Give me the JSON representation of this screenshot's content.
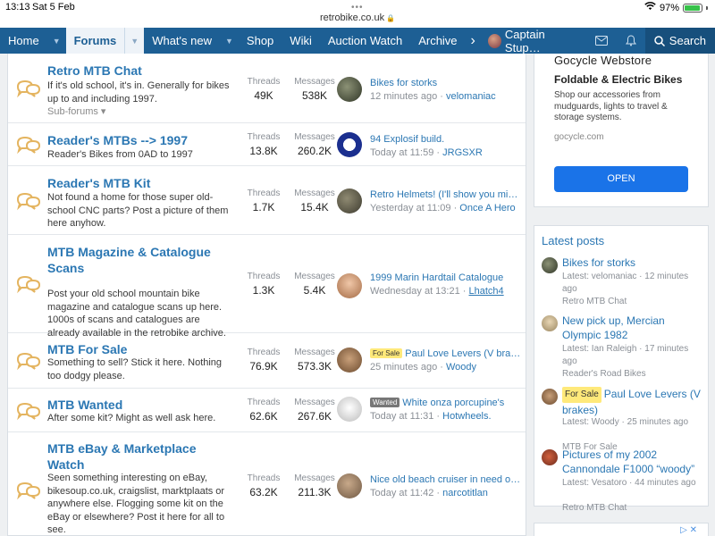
{
  "status_bar": {
    "time": "13:13",
    "date": "Sat 5 Feb",
    "battery": "97%",
    "battery_level": 0.97
  },
  "url": "retrobike.co.uk",
  "nav": {
    "home": "Home",
    "forums": "Forums",
    "whats_new": "What's new",
    "shop": "Shop",
    "wiki": "Wiki",
    "auction_watch": "Auction Watch",
    "archive": "Archive",
    "user": "Captain Stup…",
    "search": "Search"
  },
  "forums": [
    {
      "title": "Retro MTB Chat",
      "description": "If it's old school, it's in. Generally for bikes up to and including 1997.",
      "sub_forums": "Sub-forums",
      "threads_label": "Threads",
      "threads": "49K",
      "messages_label": "Messages",
      "messages": "538K",
      "last_title": "Bikes for storks",
      "last_time": "12 minutes ago",
      "last_user": "velomaniac"
    },
    {
      "title": "Reader's MTBs --> 1997",
      "description": "Reader's Bikes from 0AD to 1997",
      "threads_label": "Threads",
      "threads": "13.8K",
      "messages_label": "Messages",
      "messages": "260.2K",
      "last_title": "94 Explosif build.",
      "last_time": "Today at 11:59",
      "last_user": "JRGSXR"
    },
    {
      "title": "Reader's MTB Kit",
      "description": "Not found a home for those super old-school CNC parts? Post a picture of them here anyhow.",
      "threads_label": "Threads",
      "threads": "1.7K",
      "messages_label": "Messages",
      "messages": "15.4K",
      "last_title": "Retro Helmets! (I'll show you mine…",
      "last_time": "Yesterday at 11:09",
      "last_user": "Once A Hero"
    },
    {
      "title": "MTB Magazine & Catalogue Scans",
      "description": "Post your old school mountain bike magazine and catalogue scans up here. 1000s of scans and catalogues are already available in the retrobike archive.",
      "threads_label": "Threads",
      "threads": "1.3K",
      "messages_label": "Messages",
      "messages": "5.4K",
      "last_title": "1999 Marin Hardtail Catalogue",
      "last_time": "Wednesday at 13:21",
      "last_user": "Lhatch4"
    },
    {
      "title": "MTB For Sale",
      "description": "Something to sell? Stick it here. Nothing too dodgy please.",
      "threads_label": "Threads",
      "threads": "76.9K",
      "messages_label": "Messages",
      "messages": "573.3K",
      "last_prefix": "For Sale",
      "last_title": "Paul Love Levers (V brakes)",
      "last_time": "25 minutes ago",
      "last_user": "Woody"
    },
    {
      "title": "MTB Wanted",
      "description": "After some kit? Might as well ask here.",
      "threads_label": "Threads",
      "threads": "62.6K",
      "messages_label": "Messages",
      "messages": "267.6K",
      "last_prefix": "Wanted",
      "last_title": "White onza porcupine's",
      "last_time": "Today at 11:31",
      "last_user": "Hotwheels."
    },
    {
      "title": "MTB eBay & Marketplace Watch",
      "description": "Seen something interesting on eBay, bikesoup.co.uk, craigslist, marktplaats or anywhere else. Flogging some kit on the eBay or elsewhere? Post it here for all to see.",
      "threads_label": "Threads",
      "threads": "63.2K",
      "messages_label": "Messages",
      "messages": "211.3K",
      "last_title": "Nice old beach cruiser in need of …",
      "last_time": "Today at 11:42",
      "last_user": "narcotitlan"
    }
  ],
  "ad": {
    "brand": "Gocycle Webstore",
    "headline": "Foldable & Electric Bikes",
    "body": "Shop our accessories from mudguards, lights to travel & storage systems.",
    "url": "gocycle.com",
    "button": "OPEN"
  },
  "latest_posts": {
    "heading": "Latest posts",
    "items": [
      {
        "title": "Bikes for storks",
        "meta": "Latest: velomaniac · 12 minutes ago",
        "forum": "Retro MTB Chat"
      },
      {
        "title": "New pick up, Mercian Olympic 1982",
        "meta": "Latest: Ian Raleigh · 17 minutes ago",
        "forum": "Reader's Road Bikes"
      },
      {
        "prefix": "For Sale",
        "title": "Paul Love Levers (V brakes)",
        "meta": "Latest: Woody · 25 minutes ago",
        "forum": "MTB For Sale"
      },
      {
        "title": "Pictures of my 2002 Cannondale F1000 “woody”",
        "meta": "Latest: Vesatoro · 44 minutes ago",
        "forum": "Retro MTB Chat"
      }
    ]
  },
  "colors": {
    "nav": "#1d5f94",
    "link": "#2b77b3",
    "accent_button": "#1a73e8",
    "prefix_sale": "#ffe97a"
  }
}
